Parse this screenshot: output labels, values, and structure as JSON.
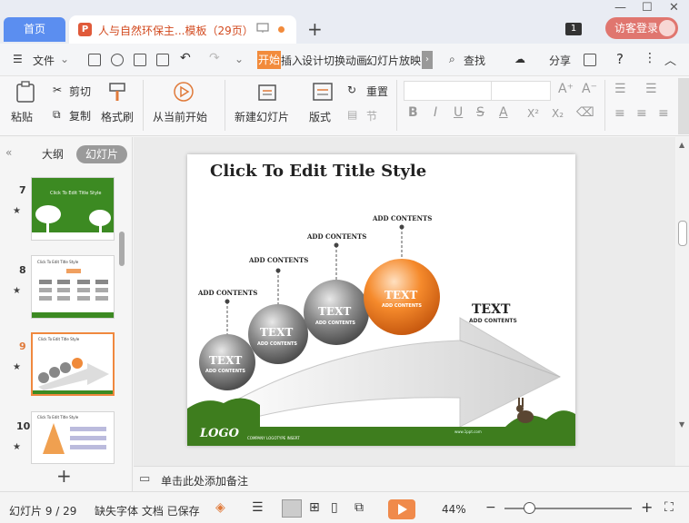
{
  "titlebar": {
    "home_tab": "首页",
    "doc_tab_icon": "P",
    "doc_tab": "人与自然环保主...模板（29页）",
    "new_tab": "+",
    "win_badge": "1",
    "visitor_login": "访客登录",
    "minimize": "—",
    "maximize": "☐",
    "close": "✕"
  },
  "menubar": {
    "hamburger": "☰",
    "file": "文件",
    "tabs": [
      "开始",
      "插入",
      "设计",
      "切换",
      "动画",
      "幻灯片放映"
    ],
    "search": "查找",
    "share": "分享",
    "help": "?",
    "more": "⋮"
  },
  "ribbon": {
    "paste": "粘贴",
    "cut": "剪切",
    "copy": "复制",
    "format_painter": "格式刷",
    "from_current": "从当前开始",
    "new_slide": "新建幻灯片",
    "layout": "版式",
    "section": "节",
    "reset": "重置",
    "bold": "B",
    "italic": "I",
    "underline": "U",
    "strike": "S",
    "font_color": "A",
    "superscript": "X²",
    "subscript": "X₂",
    "grow_font": "A⁺",
    "shrink_font": "A⁻"
  },
  "leftpanel": {
    "collapse": "«",
    "outline_tab": "大纲",
    "slides_tab": "幻灯片",
    "slides": [
      {
        "num": "7",
        "star": "★",
        "selected": false
      },
      {
        "num": "8",
        "star": "★",
        "selected": false
      },
      {
        "num": "9",
        "star": "★",
        "selected": true
      },
      {
        "num": "10",
        "star": "★",
        "selected": false
      }
    ],
    "thumb_titles": {
      "t7": "Click To Edit Title Style",
      "t8": "Click To Edit Title Style",
      "t9": "Click To Edit Title Style",
      "t10": "Click To Edit Title Style"
    },
    "add_slide": "+"
  },
  "slide": {
    "title": "Click To Edit Title Style",
    "labels": [
      "ADD CONTENTS",
      "ADD CONTENTS",
      "ADD CONTENTS",
      "ADD CONTENTS"
    ],
    "balls": [
      {
        "text": "TEXT",
        "sub": "ADD CONTENTS"
      },
      {
        "text": "TEXT",
        "sub": "ADD CONTENTS"
      },
      {
        "text": "TEXT",
        "sub": "ADD CONTENTS"
      },
      {
        "text": "TEXT",
        "sub": "ADD CONTENTS"
      }
    ],
    "arrow_text": "TEXT",
    "arrow_sub": "ADD CONTENTS",
    "logo": "LOGO",
    "logo_sub": "COMPANY LOGOTYPE INSERT",
    "footer_url": "www.1ppt.com"
  },
  "notes": {
    "placeholder": "单击此处添加备注"
  },
  "status": {
    "slide_info": "幻灯片 9 / 29",
    "font_missing": "缺失字体 文档 已保存",
    "zoom": "44%",
    "minus": "−",
    "plus": "+"
  },
  "colors": {
    "accent": "#f28b3c",
    "home_tab": "#5b8ef0",
    "visitor": "#e0766f",
    "green": "#3e7d1e"
  }
}
